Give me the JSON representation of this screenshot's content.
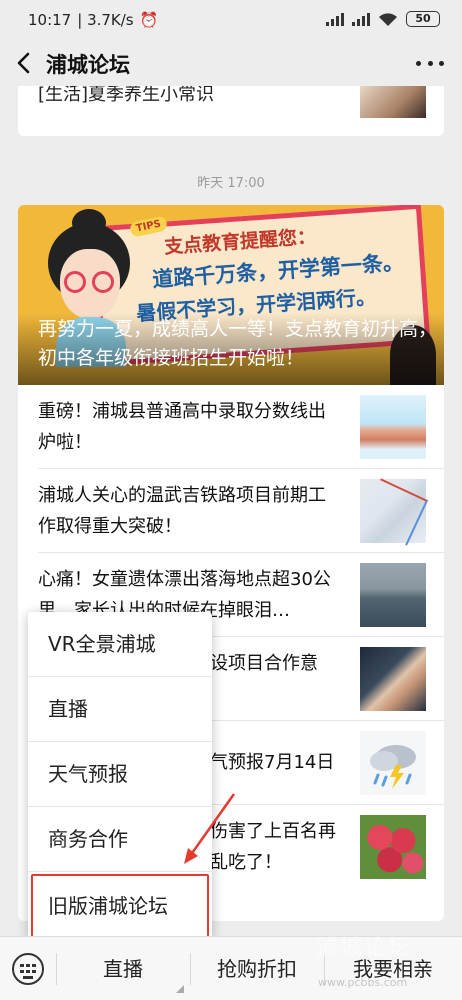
{
  "status_bar": {
    "time": "10:17",
    "network_speed": "3.7K/s",
    "battery": "50"
  },
  "nav": {
    "title": "浦城论坛"
  },
  "top_card": {
    "partial_title": "[生活]夏季养生小常识"
  },
  "timestamp": "昨天 17:00",
  "hero": {
    "tips_badge": "TIPS",
    "board_line1": "支点教育提醒您：",
    "board_line2": "道路千万条，开学第一条。",
    "board_line3": "暑假不学习，开学泪两行。",
    "title": "再努力一夏，成绩高人一等！支点教育初升高，初中各年级衔接班招生开始啦！"
  },
  "articles": [
    {
      "title": "重磅！浦城县普通高中录取分数线出炉啦！"
    },
    {
      "title": "浦城人关心的温武吉铁路项目前期工作取得重大突破！"
    },
    {
      "title": "心痛！女童遗体漂出落海地点超30公里，家长认出的时候在掉眼泪…"
    },
    {
      "title": "设项目合作意"
    },
    {
      "title": "气预报7月14日"
    },
    {
      "title": "伤害了上百名再乱吃了！"
    }
  ],
  "popup_menu": {
    "items": [
      "VR全景浦城",
      "直播",
      "天气预报",
      "商务合作",
      "旧版浦城论坛"
    ]
  },
  "bottom_tabs": [
    "直播",
    "抢购折扣",
    "我要相亲"
  ],
  "watermark": {
    "text": "浦城论坛",
    "sub": "www.pcbbs.com"
  }
}
